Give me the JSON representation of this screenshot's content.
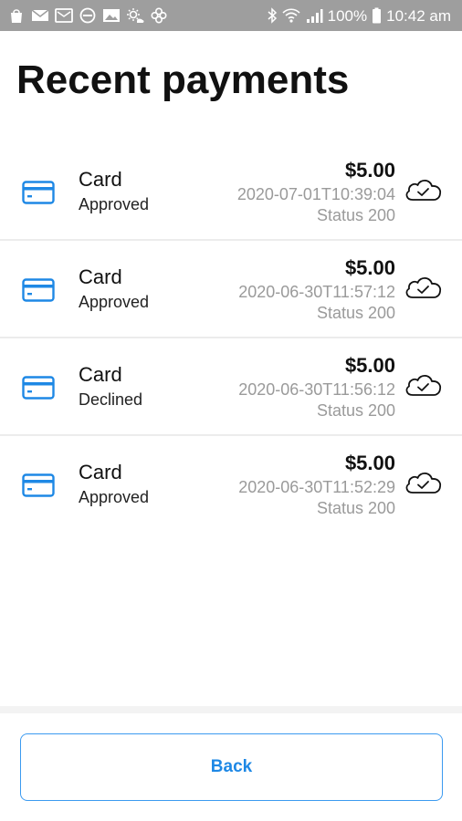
{
  "status_bar": {
    "left_icons": [
      "shopping-bag-icon",
      "mail-icon",
      "inbox-icon",
      "do-not-disturb-icon",
      "image-icon",
      "weather-icon",
      "pinwheel-icon"
    ],
    "right_icons": [
      "bluetooth-icon",
      "wifi-icon",
      "signal-icon",
      "battery-icon"
    ],
    "battery_percent": "100%",
    "time": "10:42 am"
  },
  "page": {
    "title": "Recent payments"
  },
  "payments": [
    {
      "method": "Card",
      "status": "Approved",
      "amount": "$5.00",
      "timestamp": "2020-07-01T10:39:04",
      "http_status": "Status 200",
      "icon": "credit-card-icon",
      "sync_icon": "cloud-check-icon"
    },
    {
      "method": "Card",
      "status": "Approved",
      "amount": "$5.00",
      "timestamp": "2020-06-30T11:57:12",
      "http_status": "Status 200",
      "icon": "credit-card-icon",
      "sync_icon": "cloud-check-icon"
    },
    {
      "method": "Card",
      "status": "Declined",
      "amount": "$5.00",
      "timestamp": "2020-06-30T11:56:12",
      "http_status": "Status 200",
      "icon": "credit-card-icon",
      "sync_icon": "cloud-check-icon"
    },
    {
      "method": "Card",
      "status": "Approved",
      "amount": "$5.00",
      "timestamp": "2020-06-30T11:52:29",
      "http_status": "Status 200",
      "icon": "credit-card-icon",
      "sync_icon": "cloud-check-icon"
    }
  ],
  "footer": {
    "back_label": "Back"
  },
  "colors": {
    "accent": "#1e88e5",
    "status_bar": "#9e9e9e",
    "muted_text": "#9a9a9a"
  }
}
